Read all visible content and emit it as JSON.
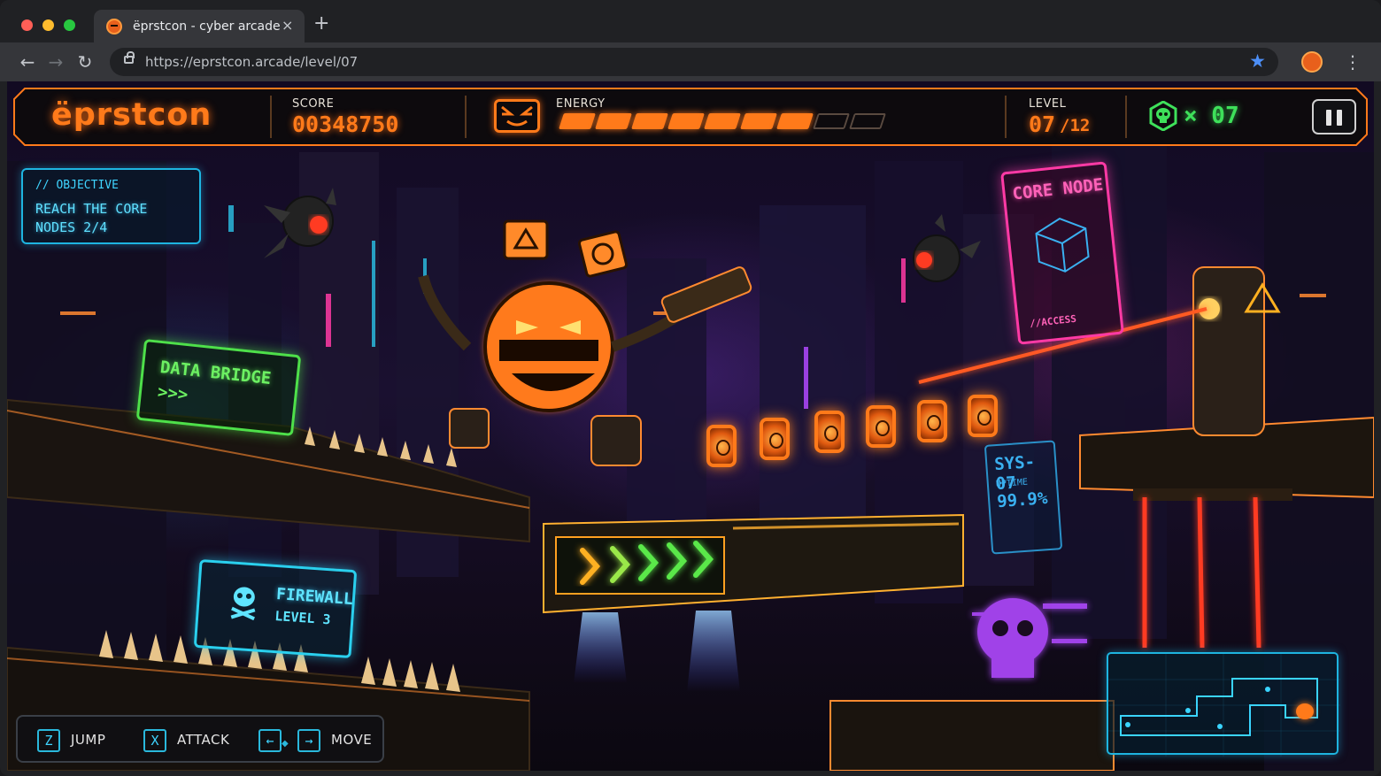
{
  "browser": {
    "tab_title": "ëprstcon - cyber arcade",
    "tab_close": "×",
    "new_tab": "+",
    "url": "https://eprstcon.arcade/level/07",
    "nav": {
      "back": "←",
      "forward": "→",
      "reload": "↻",
      "menu": "⋮",
      "star": "★"
    }
  },
  "hud": {
    "logo": "ëprstcon",
    "score_label": "SCORE",
    "score_value": "00348750",
    "energy_label": "ENERGY",
    "energy": {
      "filled": 7,
      "total": 9
    },
    "level_label": "LEVEL",
    "level_current": "07",
    "level_total": "/12",
    "lives": "× 07"
  },
  "objective": {
    "header": "// OBJECTIVE",
    "text": "REACH THE CORE NODES 2/4"
  },
  "signs": {
    "data_bridge": {
      "title": "DATA BRIDGE",
      "arrows": ">>>"
    },
    "firewall": {
      "title": "FIREWALL",
      "level": "LEVEL 3"
    },
    "core_node": {
      "title": "CORE NODE",
      "access": "//ACCESS"
    },
    "sys": {
      "title": "SYS-07",
      "uptime_label": "UPTIME",
      "uptime_value": "99.9%"
    }
  },
  "controls": [
    {
      "key": "Z",
      "action": "JUMP"
    },
    {
      "key": "X",
      "action": "ATTACK"
    },
    {
      "key_left": "←",
      "key_right": "→",
      "action": "MOVE"
    }
  ],
  "colors": {
    "accent_orange": "#ff7a1a",
    "neon_green": "#3ee05a",
    "neon_cyan": "#1eb4e0",
    "neon_pink": "#ff3aa5"
  },
  "icons": {
    "mascot": "angry-e-mascot-icon",
    "lives": "green-skull-icon",
    "pause": "pause-icon"
  }
}
